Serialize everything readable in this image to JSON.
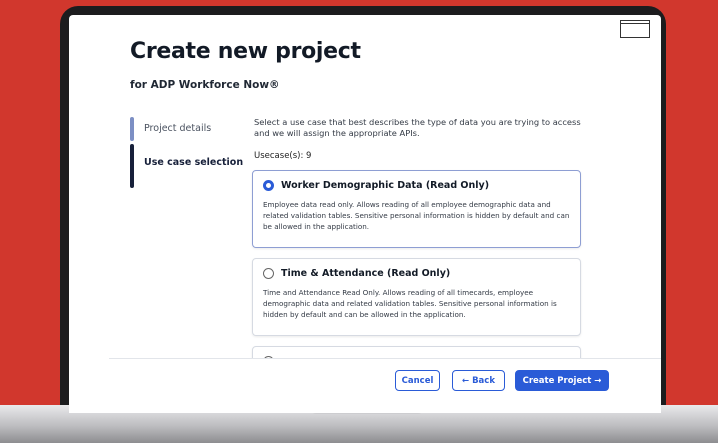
{
  "header": {
    "title": "Create new project",
    "subtitle": "for ADP Workforce Now®"
  },
  "steps": [
    {
      "label": "Project details",
      "state": "completed"
    },
    {
      "label": "Use case selection",
      "state": "active"
    }
  ],
  "main": {
    "description": "Select a use case that best describes the type of data you are trying to access and we will assign the appropriate APIs.",
    "usecase_count": "Usecase(s): 9",
    "use_cases": [
      {
        "title": "Worker Demographic Data (Read Only)",
        "description": "Employee data read only. Allows reading of all employee demographic data and related validation tables. Sensitive personal information is hidden by default and can be allowed in the application.",
        "selected": true
      },
      {
        "title": "Time & Attendance (Read Only)",
        "description": "Time and Attendance Read Only. Allows reading of all timecards, employee demographic data and related validation tables. Sensitive personal information is hidden by default and can be allowed in the application.",
        "selected": false
      }
    ]
  },
  "footer": {
    "cancel_label": "Cancel",
    "back_label": "← Back",
    "create_label": "Create Project →"
  },
  "colors": {
    "accent": "#2a5bd7",
    "background": "#d1372d",
    "active_step": "#17203a"
  }
}
